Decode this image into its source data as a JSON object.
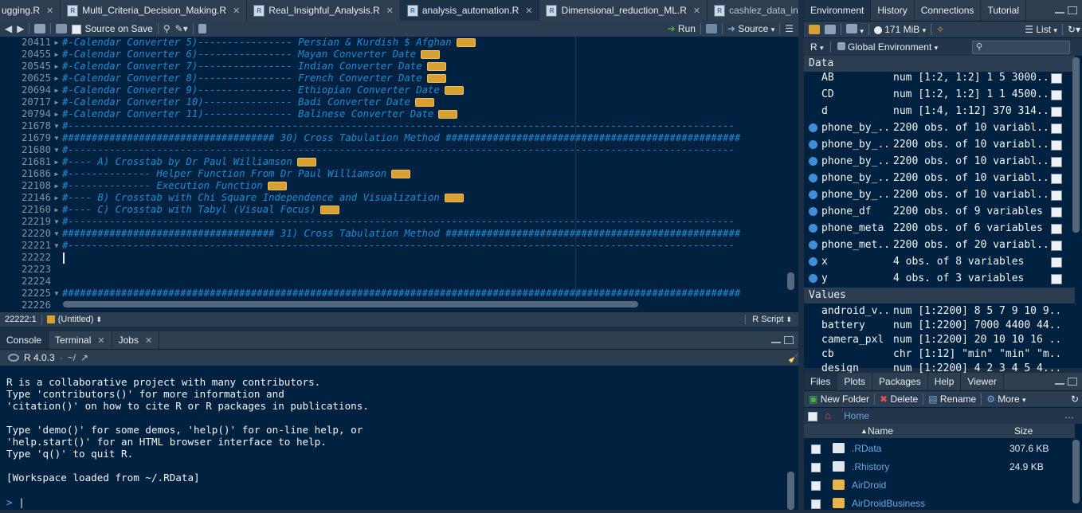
{
  "editor": {
    "tabs": [
      {
        "label": "ugging.R"
      },
      {
        "label": "Multi_Criteria_Decision_Making.R"
      },
      {
        "label": "Real_Insighful_Analysis.R"
      },
      {
        "label": "analysis_automation.R"
      },
      {
        "label": "Dimensional_reduction_ML.R"
      },
      {
        "label": "cashlez_data_interpret"
      }
    ],
    "toolbar": {
      "source_on_save": "Source on Save",
      "run": "Run",
      "source": "Source"
    },
    "lines": [
      {
        "num": "20411",
        "text": "#-Calendar Converter 5)---------------- Persian & Kurdish $ Afghan",
        "collapsed": true
      },
      {
        "num": "20455",
        "text": "#-Calendar Converter 6)---------------- Mayan Converter Date",
        "collapsed": true
      },
      {
        "num": "20545",
        "text": "#-Calendar Converter 7)---------------- Indian Converter Date",
        "collapsed": true
      },
      {
        "num": "20625",
        "text": "#-Calendar Converter 8)---------------- French Converter Date",
        "collapsed": true
      },
      {
        "num": "20694",
        "text": "#-Calendar Converter 9)---------------- Ethiopian Converter Date",
        "collapsed": true
      },
      {
        "num": "20717",
        "text": "#-Calendar Converter 10)--------------- Badi Converter Date",
        "collapsed": true
      },
      {
        "num": "20794",
        "text": "#-Calendar Converter 11)--------------- Balinese Converter Date",
        "collapsed": true
      },
      {
        "num": "21678",
        "text": "#-----------------------------------------------------------------------------------------------------------------",
        "collapsed": false
      },
      {
        "num": "21679",
        "text": "#################################### 30) Cross Tabulation Method ##################################################",
        "collapsed": false
      },
      {
        "num": "21680",
        "text": "#-----------------------------------------------------------------------------------------------------------------",
        "collapsed": false
      },
      {
        "num": "21681",
        "text": "#---- A) Crosstab by Dr Paul Williamson",
        "collapsed": true
      },
      {
        "num": "21686",
        "text": "#-------------- Helper Function From Dr Paul Williamson",
        "collapsed": true
      },
      {
        "num": "22108",
        "text": "#-------------- Execution Function",
        "collapsed": true
      },
      {
        "num": "22146",
        "text": "#---- B) Crosstab with Chi Square Independence and Visualization",
        "collapsed": true
      },
      {
        "num": "22160",
        "text": "#---- C) Crosstab with Tabyl (Visual Focus)",
        "collapsed": true
      },
      {
        "num": "22219",
        "text": "#-----------------------------------------------------------------------------------------------------------------",
        "collapsed": false
      },
      {
        "num": "22220",
        "text": "#################################### 31) Cross Tabulation Method ##################################################",
        "collapsed": false
      },
      {
        "num": "22221",
        "text": "#-----------------------------------------------------------------------------------------------------------------",
        "collapsed": false
      },
      {
        "num": "22222",
        "text": "",
        "collapsed": false
      },
      {
        "num": "22223",
        "text": "",
        "collapsed": false
      },
      {
        "num": "22224",
        "text": "",
        "collapsed": false
      },
      {
        "num": "22225",
        "text": "###################################################################################################################",
        "collapsed": false
      },
      {
        "num": "22226",
        "text": "",
        "collapsed": false
      }
    ],
    "status": {
      "position": "22222:1",
      "scope": "(Untitled)",
      "filetype": "R Script"
    }
  },
  "console": {
    "tabs": [
      {
        "label": "Console"
      },
      {
        "label": "Terminal"
      },
      {
        "label": "Jobs"
      }
    ],
    "version": "R 4.0.3",
    "path": "~/",
    "output": [
      "R is a collaborative project with many contributors.",
      "Type 'contributors()' for more information and",
      "'citation()' on how to cite R or R packages in publications.",
      "",
      "Type 'demo()' for some demos, 'help()' for on-line help, or",
      "'help.start()' for an HTML browser interface to help.",
      "Type 'q()' to quit R.",
      "",
      "[Workspace loaded from ~/.RData]"
    ],
    "prompt": ">"
  },
  "environment": {
    "tabs": [
      {
        "label": "Environment"
      },
      {
        "label": "History"
      },
      {
        "label": "Connections"
      },
      {
        "label": "Tutorial"
      }
    ],
    "memory": "171 MiB",
    "view_mode": "List",
    "language": "R",
    "scope": "Global Environment",
    "data_header": "Data",
    "data": [
      {
        "name": "AB",
        "value": "num [1:2, 1:2] 1 5 3000...",
        "expandable": false
      },
      {
        "name": "CD",
        "value": "num [1:2, 1:2] 1 1 4500...",
        "expandable": false
      },
      {
        "name": "d",
        "value": "num [1:4, 1:12] 370 314...",
        "expandable": false
      },
      {
        "name": "phone_by_...",
        "value": "2200 obs. of 10 variabl...",
        "expandable": true
      },
      {
        "name": "phone_by_...",
        "value": "2200 obs. of 10 variabl...",
        "expandable": true
      },
      {
        "name": "phone_by_...",
        "value": "2200 obs. of 10 variabl...",
        "expandable": true
      },
      {
        "name": "phone_by_...",
        "value": "2200 obs. of 10 variabl...",
        "expandable": true
      },
      {
        "name": "phone_by_...",
        "value": "2200 obs. of 10 variabl...",
        "expandable": true
      },
      {
        "name": "phone_df",
        "value": "2200 obs. of 9 variables",
        "expandable": true
      },
      {
        "name": "phone_meta",
        "value": "2200 obs. of 6 variables",
        "expandable": true
      },
      {
        "name": "phone_met...",
        "value": "2200 obs. of 20 variabl...",
        "expandable": true
      },
      {
        "name": "x",
        "value": "4 obs. of 8 variables",
        "expandable": true
      },
      {
        "name": "y",
        "value": "4 obs. of 3 variables",
        "expandable": true
      }
    ],
    "values_header": "Values",
    "values": [
      {
        "name": "android_v...",
        "value": "num [1:2200] 8 5 7 9 10 9..."
      },
      {
        "name": "battery",
        "value": "num [1:2200] 7000 4400 44..."
      },
      {
        "name": "camera_pxl",
        "value": "num [1:2200] 20 10 10 16 ..."
      },
      {
        "name": "cb",
        "value": "chr [1:12] \"min\" \"min\" \"m..."
      },
      {
        "name": "design",
        "value": "num [1:2200] 4 2 3 4 5 4..."
      }
    ]
  },
  "files": {
    "tabs": [
      {
        "label": "Files"
      },
      {
        "label": "Plots"
      },
      {
        "label": "Packages"
      },
      {
        "label": "Help"
      },
      {
        "label": "Viewer"
      }
    ],
    "toolbar": {
      "new_folder": "New Folder",
      "delete": "Delete",
      "rename": "Rename",
      "more": "More"
    },
    "breadcrumb": "Home",
    "columns": {
      "name": "Name",
      "size": "Size"
    },
    "items": [
      {
        "name": ".RData",
        "size": "307.6 KB",
        "type": "file"
      },
      {
        "name": ".Rhistory",
        "size": "24.9 KB",
        "type": "file"
      },
      {
        "name": "AirDroid",
        "size": "",
        "type": "folder"
      },
      {
        "name": "AirDroidBusiness",
        "size": "",
        "type": "folder"
      }
    ]
  },
  "colors": {
    "accent": "#1f8bd6",
    "background": "#002240",
    "chrome": "#2b3d50",
    "fold_marker": "#d8a030"
  }
}
